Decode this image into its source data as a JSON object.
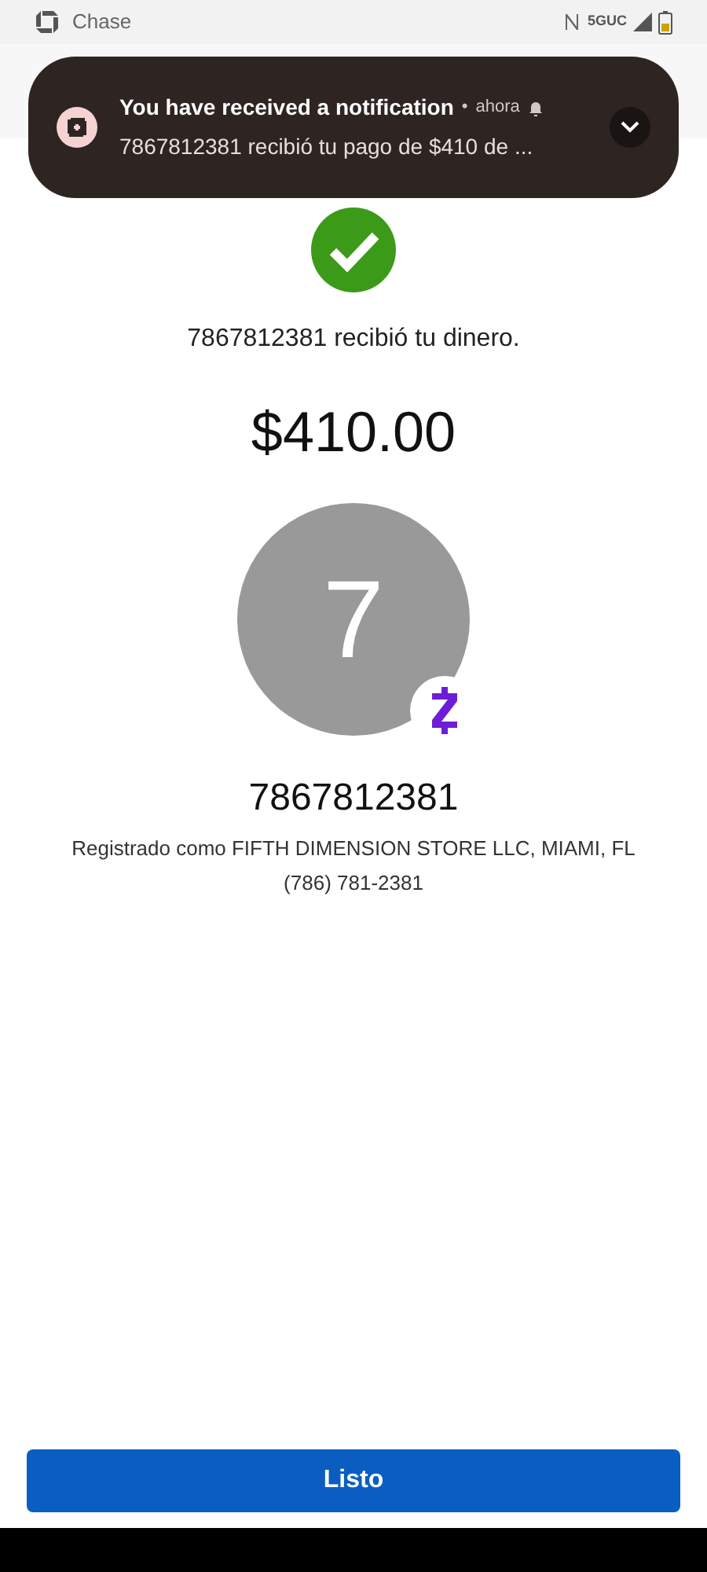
{
  "status_bar": {
    "app": "Chase",
    "network": "5GUC"
  },
  "notification": {
    "title": "You have received a notification",
    "separator": "•",
    "time": "ahora",
    "body": "7867812381 recibió tu pago de $410 de ..."
  },
  "confirmation": {
    "message": "7867812381 recibió tu dinero.",
    "amount": "$410.00"
  },
  "recipient": {
    "initial": "7",
    "name": "7867812381",
    "registered": "Registrado como FIFTH DIMENSION STORE LLC, MIAMI, FL",
    "phone": "(786) 781-2381"
  },
  "done_button": "Listo"
}
